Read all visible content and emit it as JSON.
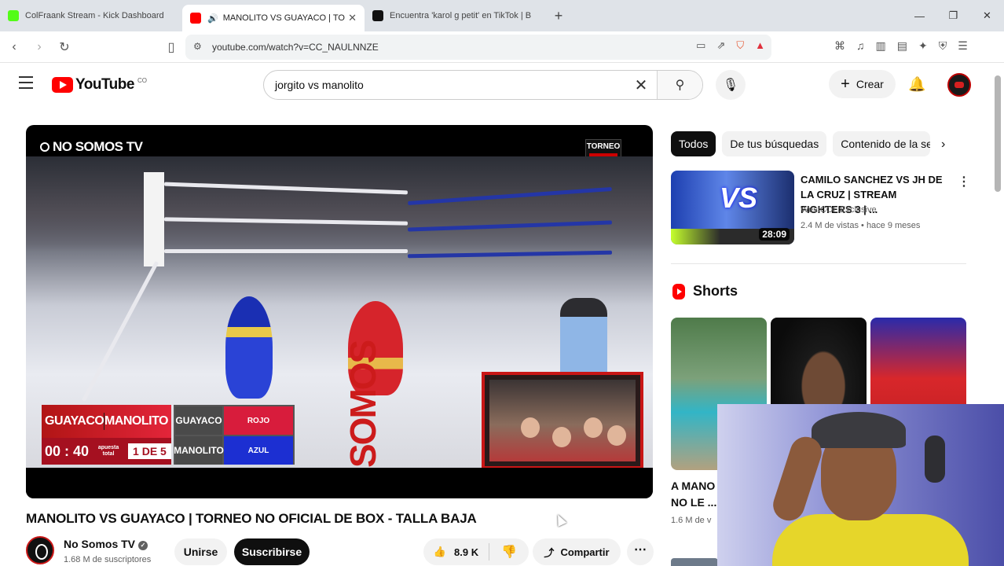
{
  "browser": {
    "tabs": [
      {
        "title": "ColFraank Stream - Kick Dashboard",
        "favicon_color": "#53fc18"
      },
      {
        "title": "MANOLITO VS GUAYACO | TO",
        "favicon_color": "#ff0000"
      },
      {
        "title": "Encuentra 'karol g petit' en TikTok | B",
        "favicon_color": "#111111"
      }
    ],
    "url": "youtube.com/watch?v=CC_NAULNNZE"
  },
  "youtube": {
    "logo_text": "YouTube",
    "country": "CO",
    "search_query": "jorgito vs  manolito",
    "create_label": "Crear"
  },
  "player": {
    "channel_logo": "NO SOMOS TV",
    "torneo_badge": "TORNEO",
    "scoreboard": {
      "names": [
        "GUAYACO",
        "MANOLITO"
      ],
      "time": "00 : 40",
      "bet_label": "apuesta total",
      "round": "1 DE 5",
      "rows": [
        {
          "name": "GUAYACO",
          "color": "ROJO"
        },
        {
          "name": "MANOLITO",
          "color": "AZUL"
        }
      ]
    },
    "banner_text": "SOMOS"
  },
  "video": {
    "title": "MANOLITO VS GUAYACO | TORNEO NO OFICIAL DE BOX - TALLA BAJA",
    "channel": "No Somos TV",
    "subscribers": "1.68 M de suscriptores",
    "join_label": "Unirse",
    "subscribe_label": "Suscribirse",
    "likes": "8.9 K",
    "share_label": "Compartir"
  },
  "sidebar": {
    "chips": [
      "Todos",
      "De tus búsquedas",
      "Contenido de la se"
    ],
    "recommended": {
      "title": "CAMILO SANCHEZ VS JH DE LA CRUZ | STREAM FIGHTERS 3 | ...",
      "channel": "WestCOL Exclusive",
      "meta": "2.4 M de vistas • hace 9 meses",
      "duration": "28:09",
      "thumb_text": "VS"
    },
    "shorts_heading": "Shorts",
    "short_title": "A MANO\nNO LE ...",
    "short_meta": "1.6 M de v"
  }
}
